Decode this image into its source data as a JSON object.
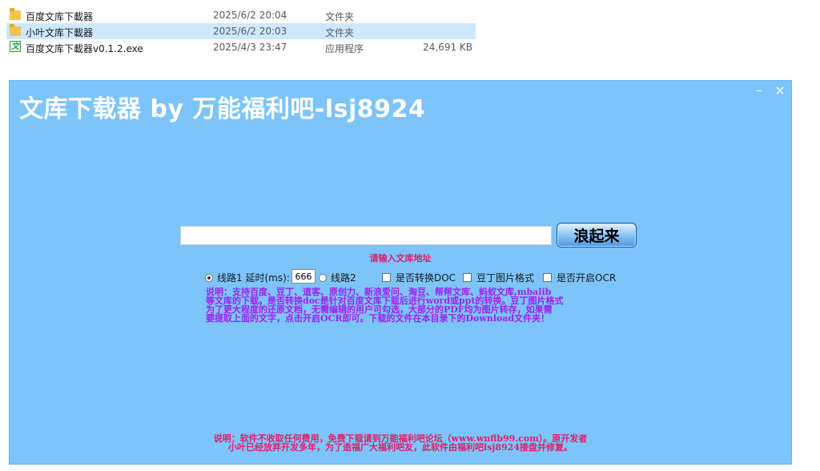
{
  "files": [
    {
      "name": "百度文库下載器",
      "date": "2025/6/2 20:04",
      "type": "文件夹",
      "size": "",
      "icon": "folder-icon"
    },
    {
      "name": "小叶文库下載器",
      "date": "2025/6/2 20:03",
      "type": "文件夹",
      "size": "",
      "icon": "folder-icon"
    },
    {
      "name": "百度文库下載器v0.1.2.exe",
      "date": "2025/4/3 23:47",
      "type": "应用程序",
      "size": "24,691 KB",
      "icon": "exe-icon"
    }
  ],
  "exe_icon_glyph": "文",
  "app": {
    "title": "文库下载器 by 万能福利吧-lsj8924",
    "minimize": "–",
    "close": "×",
    "url_value": "",
    "go_button": "浪起来",
    "hint": "请输入文库地址",
    "route1": "线路1 延时(ms):",
    "delay_value": "666",
    "route2": "线路2",
    "convert_doc": "是否转换DOC",
    "douding_format": "豆丁图片格式",
    "ocr": "是否开启OCR",
    "description": [
      "说明：支持百度、豆丁、道客、原创力、新浪爱问、淘豆、帮帮文库、蚂蚁文库,mbalib",
      "等文库的下载。是否转换doc是针对百度文库下载后进行word或ppt的转换。豆丁图片格式",
      "为了更大程度的还原文档，无需编辑的用户可勾选，大部分的PDF均为图片转存，如果需",
      "要提取上面的文字，点击开启OCR即可。下载的文件在本目录下的Download文件夹！"
    ],
    "footer": [
      "说明：软件不收取任何费用，免费下载请到万能福利吧论坛（www.wnflb99.com）。原开发者",
      "小叶已经放弃开发多年，为了造福广大福利吧友，此软件由福利吧lsj8924接盘并修复。"
    ]
  },
  "colors": {
    "window_bg": "#7cc4fa",
    "hint": "#e0206a",
    "description": "#a020f0",
    "selected_row": "#cde8ff"
  }
}
